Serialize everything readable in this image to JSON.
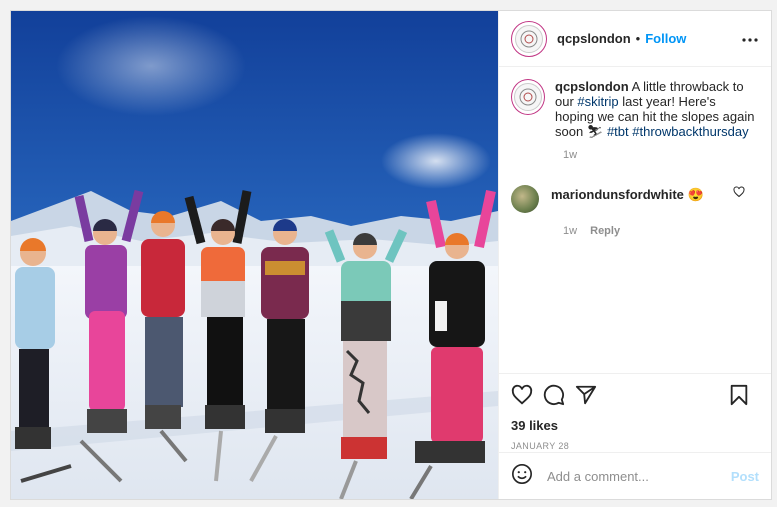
{
  "post": {
    "username": "qcpslondon",
    "follow_label": "Follow",
    "separator": "•",
    "more_label": "•••",
    "caption_username": "qcpslondon",
    "caption_text_1": " A little throwback to our ",
    "tag_skitrip": "#skitrip",
    "caption_text_2": " last year! Here's hoping we can hit the slopes again soon ",
    "emoji_skier": "⛷",
    "tag_tbt": "#tbt",
    "tag_throwback": "#throwbackthursday",
    "caption_time": "1w",
    "likes": "39 likes",
    "date": "JANUARY 28"
  },
  "comment": {
    "username": "mariondunsfordwhite",
    "emoji": "😍",
    "time": "1w",
    "reply_label": "Reply"
  },
  "add_comment": {
    "placeholder": "Add a comment...",
    "post_label": "Post"
  },
  "icons": {
    "like": "heart-icon",
    "comment": "comment-icon",
    "share": "share-icon",
    "save": "bookmark-icon",
    "emoji": "emoji-icon"
  },
  "colors": {
    "follow": "#0095f6",
    "hashtag": "#00376b",
    "post_disabled": "#b2dffc",
    "sky": "#1f4ea0"
  }
}
